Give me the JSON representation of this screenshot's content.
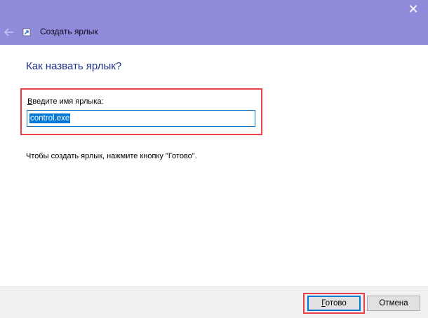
{
  "window": {
    "title": "Создать ярлык",
    "close_glyph": "✕"
  },
  "main": {
    "heading": "Как назвать ярлык?",
    "name_label_accel": "В",
    "name_label_rest": "ведите имя ярлыка:",
    "name_value": "control.exe",
    "hint": "Чтобы создать ярлык, нажмите кнопку \"Готово\"."
  },
  "footer": {
    "done_accel": "Г",
    "done_rest": "отово",
    "cancel_label": "Отмена"
  },
  "colors": {
    "titlebar": "#918bdc",
    "heading": "#1e3287",
    "highlight_box": "#e8414c",
    "selection": "#0078d7"
  },
  "icons": [
    "back-arrow-icon",
    "shortcut-icon",
    "close-icon"
  ]
}
